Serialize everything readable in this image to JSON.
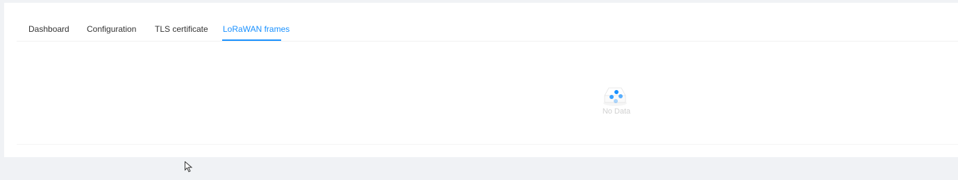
{
  "tabs": [
    {
      "label": "Dashboard",
      "active": false
    },
    {
      "label": "Configuration",
      "active": false
    },
    {
      "label": "TLS certificate",
      "active": false
    },
    {
      "label": "LoRaWAN frames",
      "active": true
    }
  ],
  "empty_state": {
    "text": "No Data",
    "icon": "empty-inbox-icon",
    "loading_icon": "loading-spinner-icon"
  },
  "colors": {
    "accent": "#1890ff",
    "text": "#333333",
    "background": "#f0f2f5",
    "card": "#ffffff"
  }
}
